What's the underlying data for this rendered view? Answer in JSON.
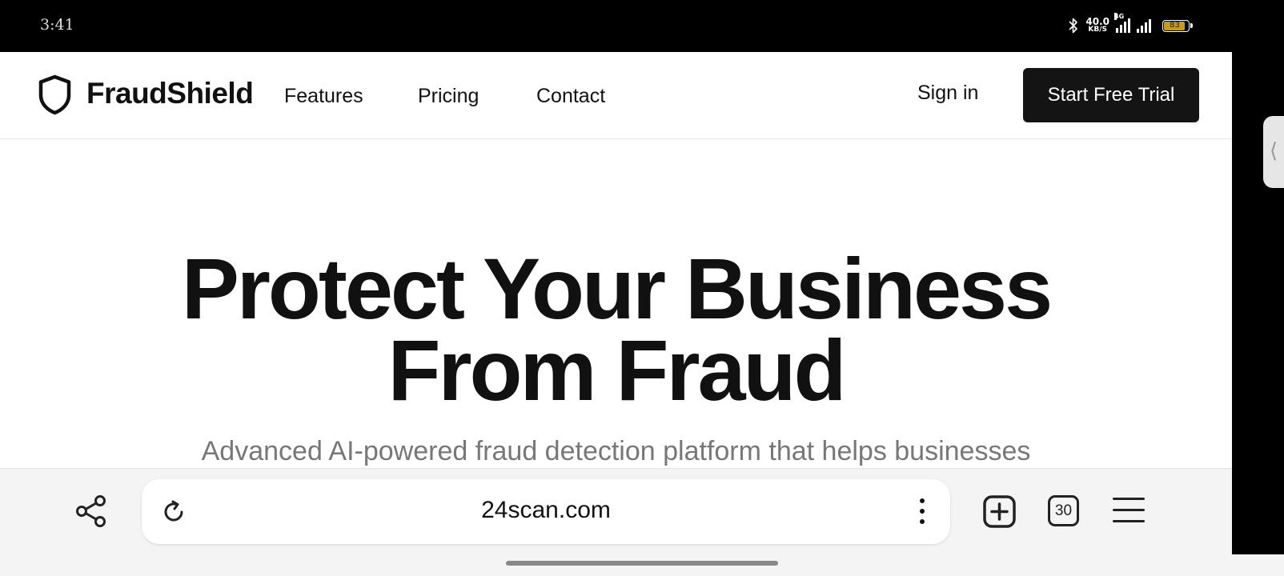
{
  "status_bar": {
    "time": "3:41",
    "net_speed_value": "40.0",
    "net_speed_unit": "KB/S",
    "network_type": "4G",
    "battery": "83"
  },
  "nav": {
    "brand": "FraudShield",
    "links": [
      "Features",
      "Pricing",
      "Contact"
    ],
    "sign_in": "Sign in",
    "cta": "Start Free Trial"
  },
  "hero": {
    "title_line1": "Protect Your Business",
    "title_line2": "From Fraud",
    "subtitle": "Advanced AI-powered fraud detection platform that helps businesses"
  },
  "browser": {
    "url": "24scan.com",
    "tab_count": "30"
  },
  "icons": {
    "logo": "shield-icon",
    "share": "share-icon",
    "reload": "reload-icon",
    "more": "more-vertical-icon",
    "new_tab": "plus-square-icon",
    "tabs": "tabs-count-icon",
    "menu": "hamburger-icon",
    "side_handle": "chevron-left-icon"
  },
  "colors": {
    "cta_bg": "#141414",
    "text": "#111111",
    "subtitle": "#777777",
    "battery": "#c79a1b"
  }
}
